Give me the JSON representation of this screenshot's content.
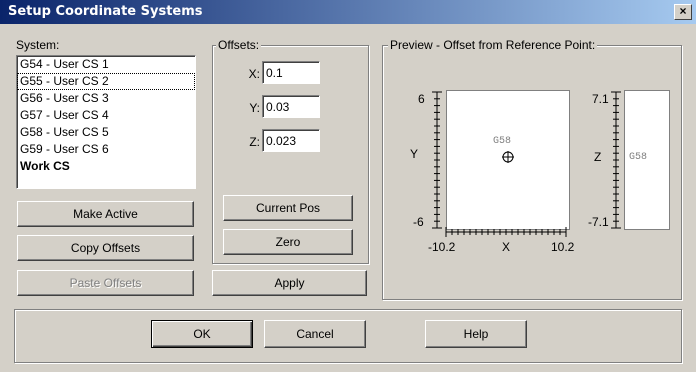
{
  "dialog": {
    "title": "Setup Coordinate Systems",
    "close_glyph": "×"
  },
  "system": {
    "label": "System:",
    "items": [
      "G54 - User CS 1",
      "G55 - User CS 2",
      "G56 - User CS 3",
      "G57 - User CS 4",
      "G58 - User CS 5",
      "G59 - User CS 6",
      "Work CS"
    ],
    "selected_index": 1
  },
  "left_buttons": {
    "make_active": "Make Active",
    "copy_offsets": "Copy Offsets",
    "paste_offsets": "Paste Offsets"
  },
  "offsets": {
    "label": "Offsets:",
    "x_label": "X:",
    "x_value": "0.1",
    "y_label": "Y:",
    "y_value": "0.03",
    "z_label": "Z:",
    "z_value": "0.023",
    "current_pos": "Current Pos",
    "zero": "Zero"
  },
  "apply_label": "Apply",
  "preview": {
    "label": "Preview - Offset from Reference Point:",
    "xy": {
      "y_max": "6",
      "y_min": "-6",
      "y_axis": "Y",
      "x_min": "-10.2",
      "x_max": "10.2",
      "x_axis": "X",
      "marker": "G58"
    },
    "z": {
      "z_max": "7.1",
      "z_min": "-7.1",
      "z_axis": "Z",
      "marker": "G58"
    }
  },
  "footer": {
    "ok": "OK",
    "cancel": "Cancel",
    "help": "Help"
  }
}
